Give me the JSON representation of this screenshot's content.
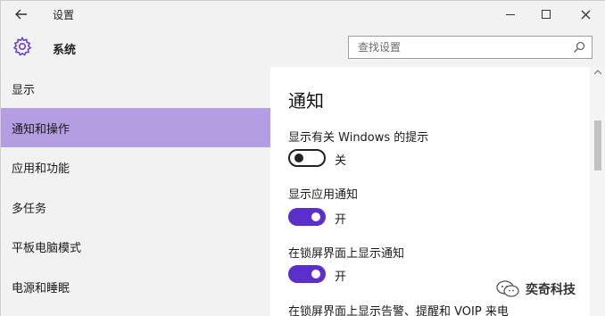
{
  "titlebar": {
    "title": "设置",
    "back_icon": "arrow-left-icon"
  },
  "header": {
    "section_title": "系统",
    "icon": "gear-icon",
    "search_placeholder": "查找设置"
  },
  "sidebar": {
    "items": [
      {
        "label": "显示"
      },
      {
        "label": "通知和操作",
        "active": true
      },
      {
        "label": "应用和功能"
      },
      {
        "label": "多任务"
      },
      {
        "label": "平板电脑模式"
      },
      {
        "label": "电源和睡眠"
      }
    ]
  },
  "main": {
    "heading": "通知",
    "settings": [
      {
        "label": "显示有关 Windows 的提示",
        "state": "关",
        "on": false
      },
      {
        "label": "显示应用通知",
        "state": "开",
        "on": true
      },
      {
        "label": "在锁屏界面上显示通知",
        "state": "开",
        "on": true
      },
      {
        "label": "在锁屏界面上显示告警、提醒和 VOIP 来电"
      }
    ]
  },
  "colors": {
    "accent": "#5b2fc9",
    "active_nav": "#b49de0",
    "chrome": "#f2f2f2"
  },
  "watermark": {
    "text": "奕奇科技"
  }
}
